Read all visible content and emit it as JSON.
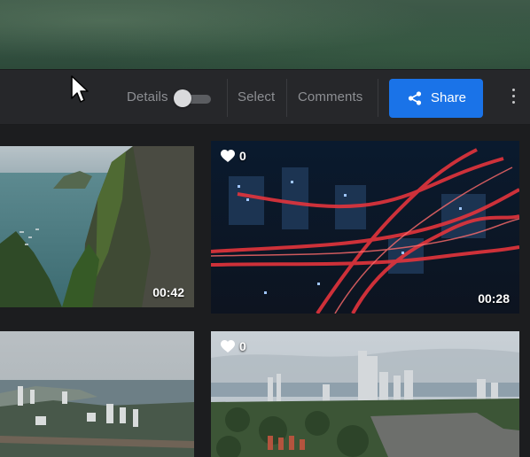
{
  "toolbar": {
    "details_label": "Details",
    "details_toggle_on": false,
    "select_label": "Select",
    "comments_label": "Comments",
    "share_label": "Share",
    "accent_color": "#1a73e8"
  },
  "icons": {
    "share": "share-icon",
    "more": "more-vertical-icon",
    "heart": "heart-icon",
    "cursor": "cursor-icon"
  },
  "media": [
    {
      "kind": "video",
      "duration": "00:42",
      "likes": null,
      "scene": "coastal cliff"
    },
    {
      "kind": "video",
      "duration": "00:28",
      "likes": "0",
      "scene": "city highways at night"
    },
    {
      "kind": "photo",
      "duration": null,
      "likes": null,
      "scene": "coastal city"
    },
    {
      "kind": "photo",
      "duration": null,
      "likes": "0",
      "scene": "city skyline"
    }
  ]
}
